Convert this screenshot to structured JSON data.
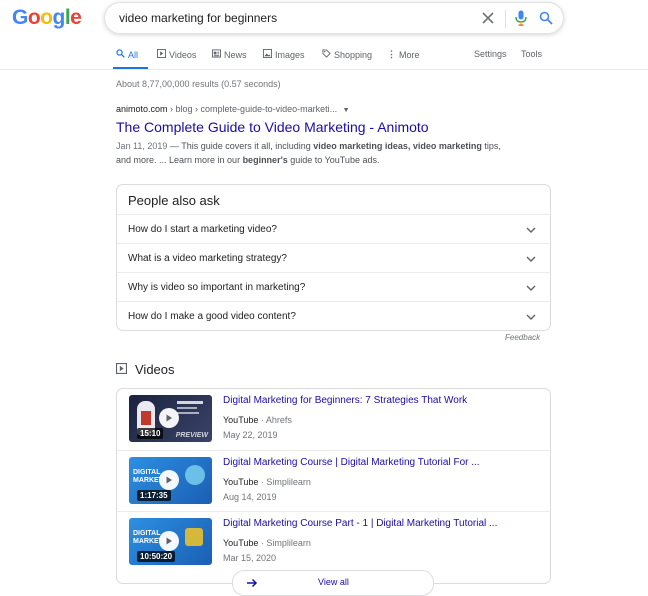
{
  "logo": {
    "text": "Google"
  },
  "search": {
    "query": "video marketing for beginners"
  },
  "tabs": [
    {
      "label": "All",
      "icon": "search-icon"
    },
    {
      "label": "Videos",
      "icon": "video-icon"
    },
    {
      "label": "News",
      "icon": "news-icon"
    },
    {
      "label": "Images",
      "icon": "image-icon"
    },
    {
      "label": "Shopping",
      "icon": "tag-icon"
    },
    {
      "label": "More",
      "icon": "more-vert-icon"
    }
  ],
  "tools": {
    "settings": "Settings",
    "tools": "Tools"
  },
  "stats": "About 8,77,00,000 results (0.57 seconds)",
  "result": {
    "cite_domain": "animoto.com",
    "cite_path": " › blog › complete-guide-to-video-marketi...",
    "title": "The Complete Guide to Video Marketing - Animoto",
    "date": "Jan 11, 2019",
    "snippet_a": " — This guide covers it all, including ",
    "snippet_b": "video marketing ideas, video marketing",
    "snippet_c": " tips,",
    "snippet_d": "and more. ... Learn more in our ",
    "snippet_e": "beginner's",
    "snippet_f": " guide to YouTube ads."
  },
  "paa": {
    "title": "People also ask",
    "questions": [
      "How do I start a marketing video?",
      "What is a video marketing strategy?",
      "Why is video so important in marketing?",
      "How do I make a good video content?"
    ],
    "feedback": "Feedback"
  },
  "videos": {
    "heading": "Videos",
    "items": [
      {
        "title": "Digital Marketing for Beginners: 7 Strategies That Work",
        "source": "YouTube",
        "channel": "Ahrefs",
        "date": "May 22, 2019",
        "duration": "15:10",
        "badge": "PREVIEW"
      },
      {
        "title": "Digital Marketing Course | Digital Marketing Tutorial For ...",
        "source": "YouTube",
        "channel": "Simplilearn",
        "date": "Aug 14, 2019",
        "duration": "1:17:35",
        "thumb_text": "DIGITAL MARKETING"
      },
      {
        "title": "Digital Marketing Course Part - 1 | Digital Marketing Tutorial ...",
        "source": "YouTube",
        "channel": "Simplilearn",
        "date": "Mar 15, 2020",
        "duration": "10:50:20",
        "thumb_text": "DIGITAL MARKETING"
      }
    ],
    "view_all": "View all"
  },
  "colors": {
    "link": "#1a0dab",
    "accent": "#1a73e8"
  }
}
